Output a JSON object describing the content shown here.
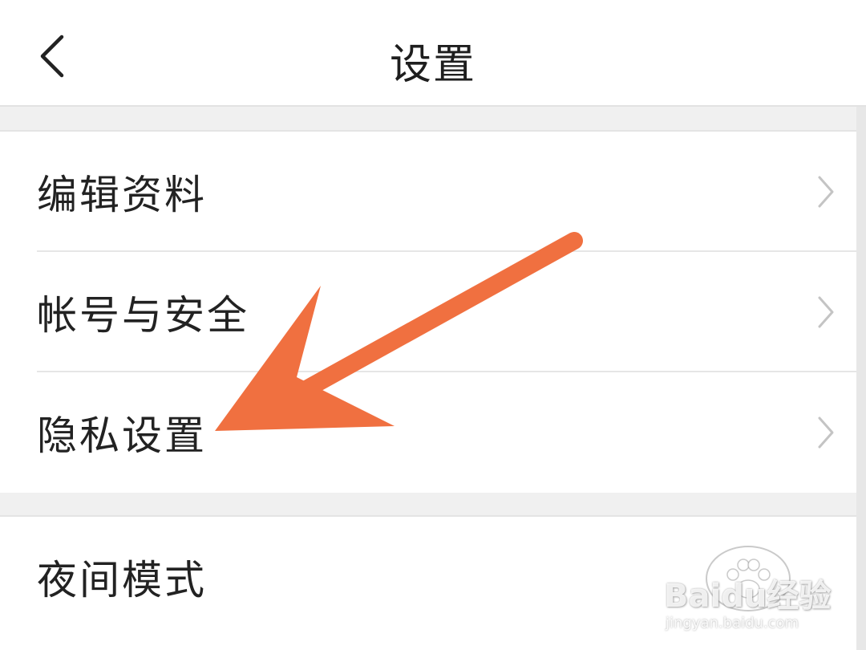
{
  "header": {
    "title": "设置"
  },
  "settings_groups": [
    {
      "items": [
        {
          "label": "编辑资料"
        },
        {
          "label": "帐号与安全"
        },
        {
          "label": "隐私设置"
        }
      ]
    },
    {
      "items": [
        {
          "label": "夜间模式"
        }
      ]
    }
  ],
  "annotation": {
    "color": "#f07040",
    "target": "隐私设置"
  },
  "watermark": {
    "brand": "Baidu经验",
    "url": "jingyan.baidu.com"
  }
}
